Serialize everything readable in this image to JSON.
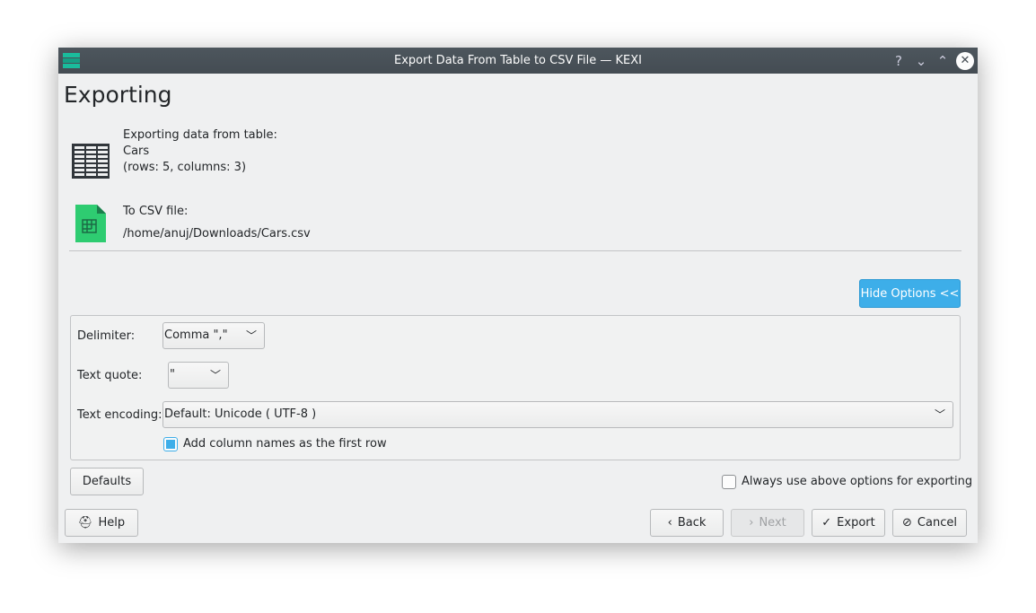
{
  "window": {
    "title": "Export Data From Table to CSV File — KEXI",
    "buttons": {
      "help": "?",
      "minimize": "⌄",
      "maximize": "⌃",
      "close": "✕"
    }
  },
  "page": {
    "heading": "Exporting"
  },
  "source": {
    "label": "Exporting data from table:",
    "table": "Cars",
    "info": "(rows: 5, columns: 3)"
  },
  "target": {
    "label": "To CSV file:",
    "path": "/home/anuj/Downloads/Cars.csv"
  },
  "hide_options": "Hide Options <<",
  "options": {
    "delimiter_label": "Delimiter:",
    "delimiter_value": "Comma \",\"",
    "quote_label": "Text quote:",
    "quote_value": "\"",
    "encoding_label": "Text encoding:",
    "encoding_value": "Default: Unicode ( UTF-8 )",
    "add_column_names": {
      "label": "Add column names as the first row",
      "checked": true
    }
  },
  "defaults": "Defaults",
  "always_use": {
    "label": "Always use above options for exporting",
    "checked": false
  },
  "footer": {
    "help": "Help",
    "back": "Back",
    "next": "Next",
    "export": "Export",
    "cancel": "Cancel"
  },
  "colors": {
    "accent": "#3daee9",
    "titlebar": "#474f56",
    "file_icon": "#2ecc71"
  }
}
